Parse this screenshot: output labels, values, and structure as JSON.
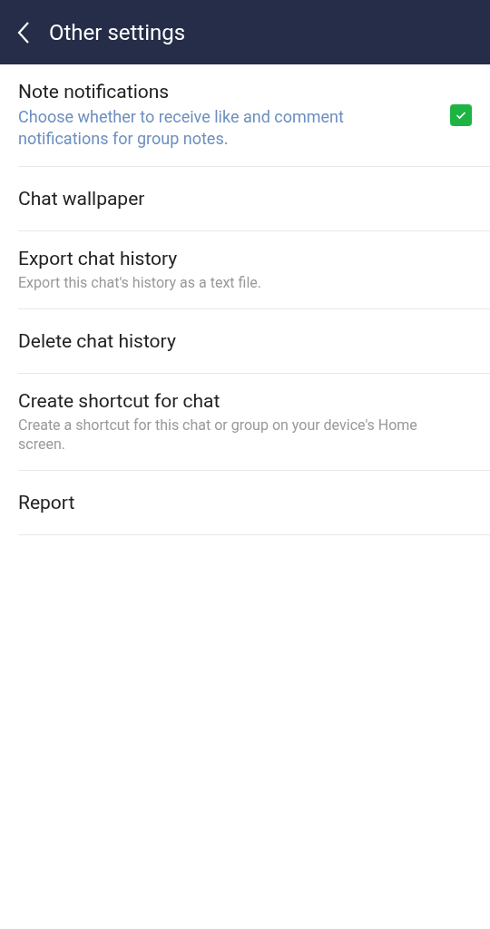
{
  "header": {
    "title": "Other settings"
  },
  "items": [
    {
      "kind": "checkbox",
      "title": "Note notifications",
      "description": "Choose whether to receive like and comment notifications for group notes.",
      "checked": true
    },
    {
      "kind": "plain",
      "title": "Chat wallpaper"
    },
    {
      "kind": "plain",
      "title": "Export chat history",
      "description": "Export this chat's history as a text file."
    },
    {
      "kind": "plain",
      "title": "Delete chat history"
    },
    {
      "kind": "plain",
      "title": "Create shortcut for chat",
      "description": "Create a shortcut for this chat or group on your device's Home screen."
    },
    {
      "kind": "plain",
      "title": "Report"
    }
  ]
}
